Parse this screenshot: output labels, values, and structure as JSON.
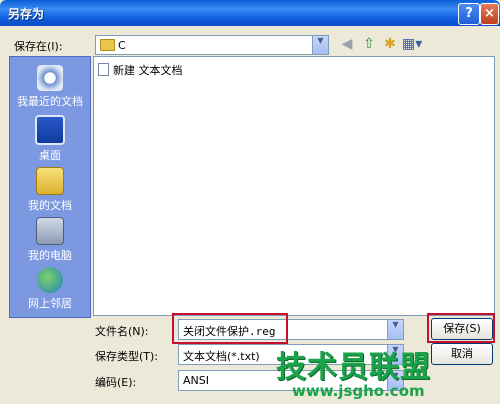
{
  "window": {
    "title": "另存为",
    "help_symbol": "?",
    "close_symbol": "×"
  },
  "toolbar": {
    "save_in_label": "保存在(I):",
    "location": "C",
    "back_icon": "back-icon",
    "up_icon": "up-folder-icon",
    "new_folder_icon": "new-folder-icon",
    "views_icon": "views-menu-icon"
  },
  "places": [
    {
      "label": "我最近的文档",
      "icon": "recent-documents-icon"
    },
    {
      "label": "桌面",
      "icon": "desktop-icon"
    },
    {
      "label": "我的文档",
      "icon": "my-documents-icon"
    },
    {
      "label": "我的电脑",
      "icon": "my-computer-icon"
    },
    {
      "label": "网上邻居",
      "icon": "network-places-icon"
    }
  ],
  "files": [
    {
      "name": "新建 文本文档",
      "icon": "text-document-icon"
    }
  ],
  "form": {
    "filename_label": "文件名(N):",
    "filename_value": "关闭文件保护.reg",
    "filetype_label": "保存类型(T):",
    "filetype_value": "文本文档(*.txt)",
    "encoding_label": "编码(E):",
    "encoding_value": "ANSI"
  },
  "buttons": {
    "save_label": "保存(S)",
    "cancel_label": "取消"
  },
  "watermark": {
    "brand": "技术员联盟",
    "url": "www.jsgho.com"
  },
  "colors": {
    "highlight_box": "#c8102e",
    "places_bar": "#7b98e1",
    "titlebar": "#0a5fd8"
  }
}
